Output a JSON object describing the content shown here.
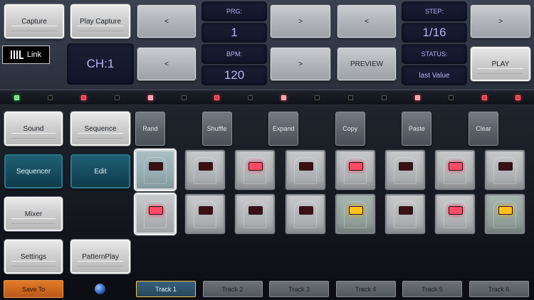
{
  "top": {
    "capture": "Capture",
    "play_capture": "Play Capture",
    "prg_label": "PRG:",
    "prg_value": "1",
    "step_label": "STEP:",
    "step_value": "1/16",
    "bpm_label": "BPM:",
    "bpm_value": "120",
    "status_label": "STATUS:",
    "status_value": "last Value",
    "channel": "CH:1",
    "prev": "<",
    "next": ">",
    "preview": "PREVIEW",
    "play": "PLAY",
    "link_logo": "Link"
  },
  "indicators": [
    "green",
    "off",
    "red",
    "off",
    "pink",
    "off",
    "red",
    "off",
    "pink",
    "off",
    "off",
    "off",
    "pink",
    "off",
    "red",
    "red"
  ],
  "nav": {
    "sound": "Sound",
    "sequence": "Sequence",
    "sequencer": "Sequencer",
    "edit": "Edit",
    "mixer": "Mixer",
    "settings": "Settings",
    "pattern_play": "PatternPlay",
    "save_to": "Save To"
  },
  "actions": [
    "Rand",
    "Shuffle",
    "Expand",
    "Copy",
    "Paste",
    "Clear"
  ],
  "pads": {
    "row1": [
      "off",
      "off",
      "red",
      "off",
      "red",
      "off",
      "red",
      "off"
    ],
    "row2": [
      "red",
      "off",
      "off",
      "off",
      "amber",
      "off",
      "red",
      "amber"
    ]
  },
  "tracks": [
    "Track 1",
    "Track 2",
    "Track 3",
    "Track 4",
    "Track 5",
    "Track 6"
  ],
  "colors": {
    "accent_blue": "#164a5c",
    "display_text": "#b6b3ef",
    "save_orange": "#d06d22",
    "selected_track_border": "#f6c24a"
  }
}
